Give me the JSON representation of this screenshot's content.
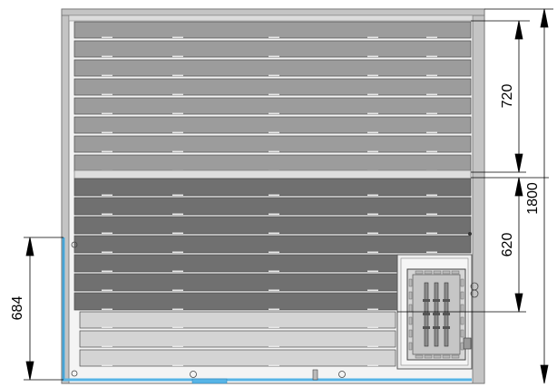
{
  "drawing": {
    "dimensions": {
      "upper_bench_depth": "720",
      "lower_bench_depth": "620",
      "total_depth": "1800",
      "door_offset": "684"
    }
  },
  "colors": {
    "frame": "#b8b8b8",
    "frame_edge": "#6e6e6e",
    "upper_bench": "#9c9c9c",
    "lower_bench": "#707070",
    "floor_slats": "#d4d4d4",
    "heater_panel": "#e2e2e2",
    "glass": "#56b4e6",
    "dimension_line": "#000000"
  }
}
